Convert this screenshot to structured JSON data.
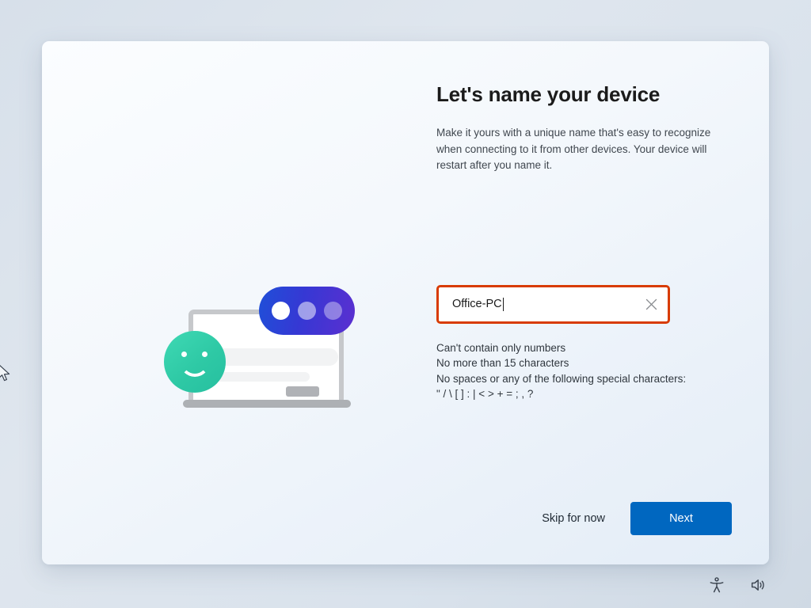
{
  "page": {
    "title": "Let's name your device",
    "subtitle": "Make it yours with a unique name that's easy to recognize when connecting to it from other devices. Your device will restart after you name it."
  },
  "device_name_field": {
    "value": "Office-PC",
    "placeholder": "",
    "clear_icon": "close-icon",
    "validation_state": "error",
    "error_border_color": "#d83b01"
  },
  "rules": [
    "Can't contain only numbers",
    "No more than 15 characters",
    "No spaces or any of the following special characters:",
    "\" / \\ [ ] : | < > + = ; , ?"
  ],
  "footer": {
    "skip_label": "Skip for now",
    "next_label": "Next",
    "next_color": "#0067c0"
  },
  "system_tray": {
    "accessibility_icon": "accessibility-icon",
    "volume_icon": "speaker-icon"
  },
  "illustration": {
    "name": "device-naming-illustration",
    "laptop_color": "#c6c8cb",
    "smiley_color": "#2ec9a5",
    "bubble_gradient_start": "#1f4fd8",
    "bubble_gradient_end": "#5b2fd0"
  }
}
